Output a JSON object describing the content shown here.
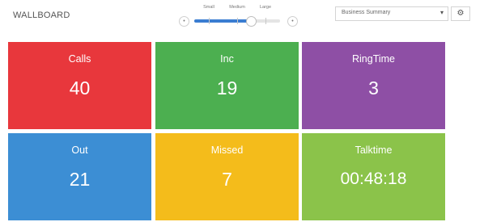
{
  "header": {
    "title": "WALLBOARD",
    "size_slider": {
      "labels": [
        "Small",
        "Medium",
        "Large"
      ],
      "value": 0.66
    },
    "dropdown": {
      "value": "Business Summary",
      "caret_icon": "chevron-down-icon"
    },
    "settings_icon": "gear-icon"
  },
  "tiles": [
    {
      "label": "Calls",
      "value": "40",
      "color": "#e8373c"
    },
    {
      "label": "Inc",
      "value": "19",
      "color": "#4caf50"
    },
    {
      "label": "RingTime",
      "value": "3",
      "color": "#8e4fa5"
    },
    {
      "label": "Out",
      "value": "21",
      "color": "#3c8ed4"
    },
    {
      "label": "Missed",
      "value": "7",
      "color": "#f4bc1b"
    },
    {
      "label": "Talktime",
      "value": "00:48:18",
      "color": "#8bc34a"
    }
  ]
}
